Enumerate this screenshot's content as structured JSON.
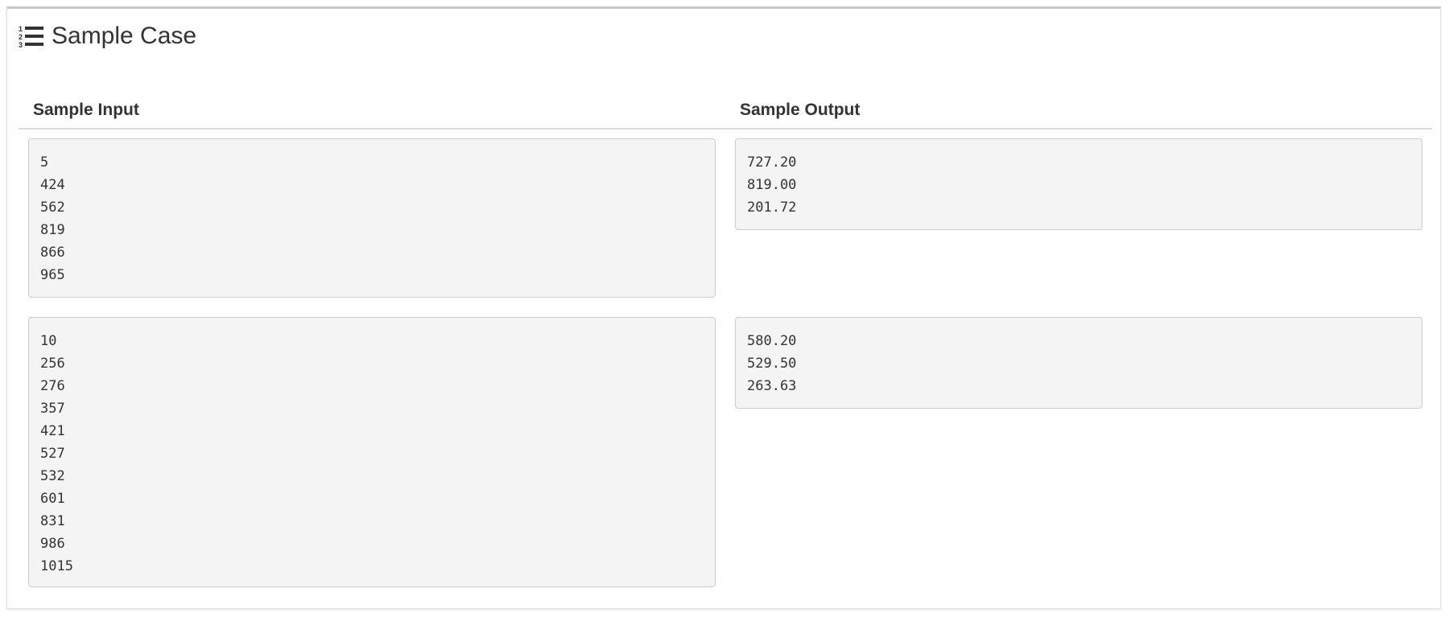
{
  "panel": {
    "title": "Sample Case",
    "icon": "list-ol-icon"
  },
  "columns": {
    "input_header": "Sample Input",
    "output_header": "Sample Output"
  },
  "cases": [
    {
      "input": "5\n424\n562\n819\n866\n965",
      "output": "727.20\n819.00\n201.72"
    },
    {
      "input": "10\n256\n276\n357\n421\n527\n532\n601\n831\n986\n1015",
      "output": "580.20\n529.50\n263.63"
    }
  ]
}
